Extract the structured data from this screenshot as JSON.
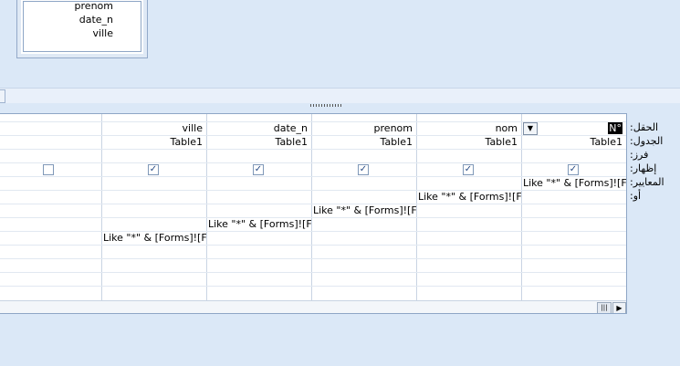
{
  "table_box": {
    "fields": [
      "prenom",
      "date_n",
      "ville"
    ]
  },
  "row_labels": {
    "field": "الحقل:",
    "table": "الجدول:",
    "sort": "فرز:",
    "show": "إظهار:",
    "criteria": "المعايير:",
    "or": "أو:"
  },
  "columns": [
    {
      "field": "N°",
      "table": "Table1",
      "show": true,
      "criteria_row": 0,
      "criteria": "Like \"*\" & [Forms]![Forı"
    },
    {
      "field": "nom",
      "table": "Table1",
      "show": true,
      "criteria_row": 1,
      "criteria": "Like \"*\" & [Forms]![Forı"
    },
    {
      "field": "prenom",
      "table": "Table1",
      "show": true,
      "criteria_row": 2,
      "criteria": "Like \"*\" & [Forms]![Forı"
    },
    {
      "field": "date_n",
      "table": "Table1",
      "show": true,
      "criteria_row": 3,
      "criteria": "Like \"*\" & [Forms]![Forı"
    },
    {
      "field": "ville",
      "table": "Table1",
      "show": true,
      "criteria_row": 4,
      "criteria": "Like \"*\" & [Forms]![Forı"
    },
    {
      "field": "",
      "table": "",
      "show": false,
      "criteria_row": -1,
      "criteria": ""
    }
  ],
  "icons": {
    "dropdown": "chevron-down-icon",
    "check": "check-icon",
    "scroll_right": "arrow-right-icon",
    "scroll_thumb": "scroll-thumb-icon"
  }
}
